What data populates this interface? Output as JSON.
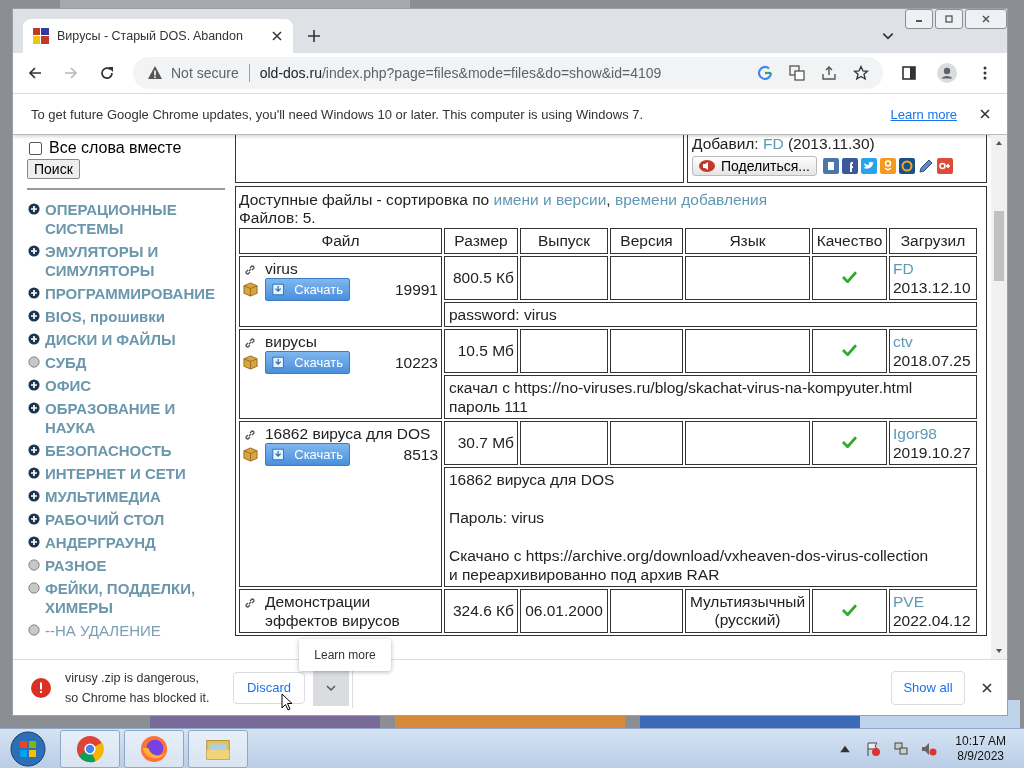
{
  "window": {
    "tab_title": "Вирусы - Старый DOS. Abandon",
    "security": "Not secure",
    "url_host": "old-dos.ru",
    "url_path": "/index.php?page=files&mode=files&do=show&id=4109"
  },
  "info_bar": {
    "text": "To get future Google Chrome updates, you'll need Windows 10 or later. This computer is using Windows 7.",
    "link": "Learn more"
  },
  "sidebar": {
    "search_option": {
      "label": "Все слова вместе",
      "checked": false
    },
    "search_button": "Поиск",
    "categories": [
      {
        "label": "ОПЕРАЦИОННЫЕ СИСТЕМЫ",
        "kind": "group"
      },
      {
        "label": "ЭМУЛЯТОРЫ И СИМУЛЯТОРЫ",
        "kind": "group"
      },
      {
        "label": "ПРОГРАММИРОВАНИЕ",
        "kind": "group"
      },
      {
        "label": "BIOS, прошивки",
        "kind": "group"
      },
      {
        "label": "ДИСКИ И ФАЙЛЫ",
        "kind": "group"
      },
      {
        "label": "СУБД",
        "kind": "leaf"
      },
      {
        "label": "ОФИС",
        "kind": "group"
      },
      {
        "label": "ОБРАЗОВАНИЕ И НАУКА",
        "kind": "group"
      },
      {
        "label": "БЕЗОПАСНОСТЬ",
        "kind": "group"
      },
      {
        "label": "ИНТЕРНЕТ И СЕТИ",
        "kind": "group"
      },
      {
        "label": "МУЛЬТИМЕДИА",
        "kind": "group"
      },
      {
        "label": "РАБОЧИЙ СТОЛ",
        "kind": "group"
      },
      {
        "label": "АНДЕРГРАУНД",
        "kind": "group"
      },
      {
        "label": "РАЗНОЕ",
        "kind": "leaf"
      },
      {
        "label": "ФЕЙКИ, ПОДДЕЛКИ, ХИМЕРЫ",
        "kind": "leaf"
      },
      {
        "label": "--НА УДАЛЕНИЕ",
        "kind": "removed"
      }
    ]
  },
  "added": {
    "label": "Добавил:",
    "user": "FD",
    "date": "(2013.11.30)",
    "share": "Поделиться..."
  },
  "files": {
    "sort_line": [
      {
        "text": "Доступные файлы - сортировка по ",
        "link": false
      },
      {
        "text": "имени и версии",
        "link": true
      },
      {
        "text": ", ",
        "link": false
      },
      {
        "text": "времени добавления",
        "link": true
      }
    ],
    "count": "Файлов: 5.",
    "columns": [
      "Файл",
      "Размер",
      "Выпуск",
      "Версия",
      "Язык",
      "Качество",
      "Загрузил"
    ],
    "rows": [
      {
        "name": "virus",
        "button": "Скачать",
        "downloads": "19991",
        "size": "800.5 Кб",
        "release": "",
        "version": "",
        "language": "",
        "quality": true,
        "uploader": "FD",
        "date": "2013.12.10",
        "notes": [
          "password: virus"
        ]
      },
      {
        "name": "вирусы",
        "button": "Скачать",
        "downloads": "10223",
        "size": "10.5 Мб",
        "release": "",
        "version": "",
        "language": "",
        "quality": true,
        "uploader": "ctv",
        "date": "2018.07.25",
        "notes": [
          "скачал с https://no-viruses.ru/blog/skachat-virus-na-kompyuter.html\nпароль 111"
        ]
      },
      {
        "name": "16862 вируса для DOS",
        "button": "Скачать",
        "downloads": "8513",
        "size": "30.7 Мб",
        "release": "",
        "version": "",
        "language": "",
        "quality": true,
        "uploader": "Igor98",
        "date": "2019.10.27",
        "notes": [
          "16862 вируса для DOS",
          "Пароль: virus",
          "Скачано с https://archive.org/download/vxheaven-dos-virus-collection\nи переархивированно под архив RAR"
        ]
      },
      {
        "name": "Демонстрации эффектов вирусов",
        "size": "324.6 Кб",
        "release": "06.01.2000",
        "version": "",
        "language": "Мультиязычный (русский)",
        "quality": true,
        "uploader": "PVE",
        "date": "2022.04.12",
        "notes": []
      }
    ]
  },
  "download_bar": {
    "message": "virusy .zip is dangerous,\nso Chrome has blocked it.",
    "discard": "Discard",
    "menu_item": "Learn more",
    "show_all": "Show all"
  },
  "taskbar": {
    "time": "10:17 AM",
    "date": "8/9/2023"
  }
}
